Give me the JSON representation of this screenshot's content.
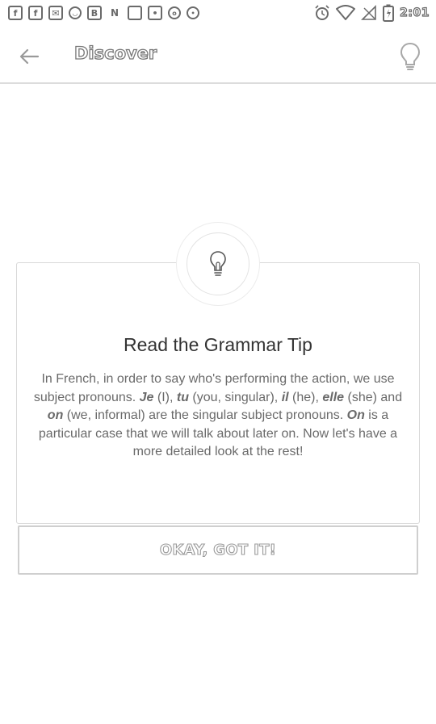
{
  "status_bar": {
    "left_icons": [
      {
        "name": "facebook-icon",
        "glyph": "f"
      },
      {
        "name": "facebook-icon-2",
        "glyph": "f"
      },
      {
        "name": "chat-icon",
        "glyph": "✉"
      },
      {
        "name": "cat-icon",
        "glyph": "◡"
      },
      {
        "name": "b-icon",
        "glyph": "B"
      },
      {
        "name": "n-icon",
        "glyph": "N"
      },
      {
        "name": "square-icon",
        "glyph": ""
      },
      {
        "name": "lock-icon",
        "glyph": "•"
      },
      {
        "name": "circle-icon",
        "glyph": "o"
      },
      {
        "name": "smile-icon",
        "glyph": "•"
      }
    ],
    "right_icons": [
      "alarm-icon",
      "wifi-icon",
      "signal-off-icon",
      "battery-icon"
    ],
    "time": "2:01"
  },
  "header": {
    "back_icon": "arrow-left-icon",
    "title": "Discover",
    "tip_icon": "lightbulb-icon"
  },
  "card": {
    "icon": "lightbulb-icon",
    "heading": "Read the Grammar Tip",
    "body_segments": [
      {
        "text": "In French, in order to say who's performing the action, we use subject pronouns. ",
        "emphasis": false
      },
      {
        "text": "Je",
        "emphasis": true
      },
      {
        "text": " (I), ",
        "emphasis": false
      },
      {
        "text": "tu",
        "emphasis": true
      },
      {
        "text": " (you, singular), ",
        "emphasis": false
      },
      {
        "text": "il",
        "emphasis": true
      },
      {
        "text": " (he), ",
        "emphasis": false
      },
      {
        "text": "elle",
        "emphasis": true
      },
      {
        "text": " (she) and ",
        "emphasis": false
      },
      {
        "text": "on",
        "emphasis": true
      },
      {
        "text": " (we, informal) are the singular subject pronouns. ",
        "emphasis": false
      },
      {
        "text": "On",
        "emphasis": true
      },
      {
        "text": " is a particular case that we will talk about later on. Now let's have a more detailed look at the rest!",
        "emphasis": false
      }
    ],
    "button_label": "OKAY, GOT IT!"
  },
  "colors": {
    "icon_gray": "#6a6a6a",
    "divider": "#dcdcdc",
    "heading_text": "#333333",
    "body_text": "#6a6a6a"
  }
}
